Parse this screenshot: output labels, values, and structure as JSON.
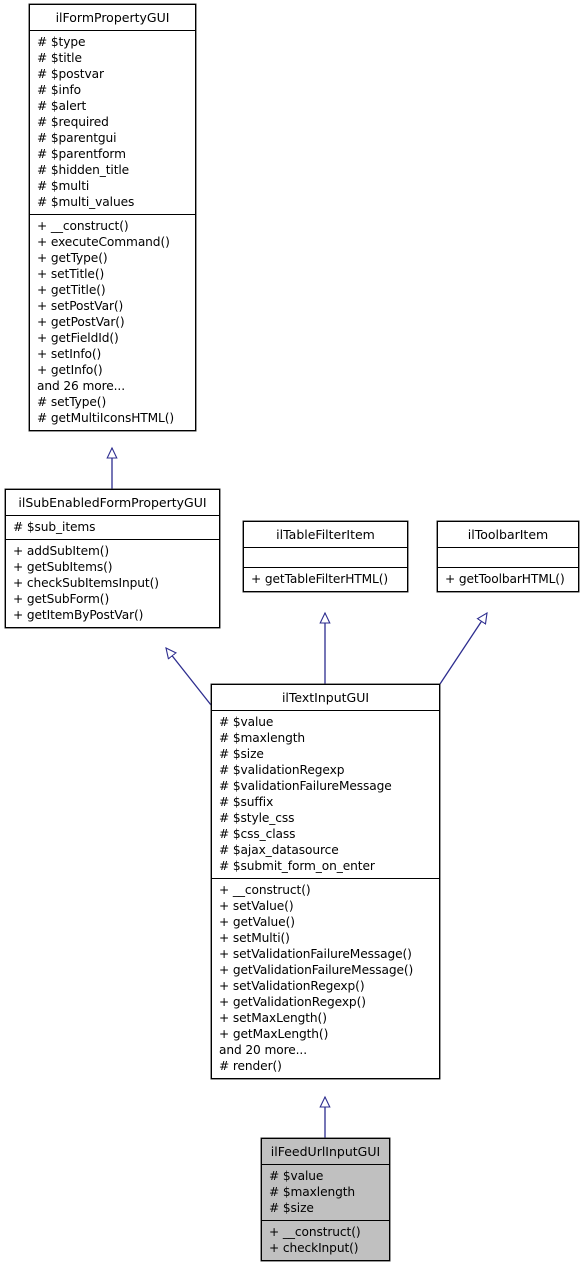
{
  "diagram": {
    "type": "uml-class-inheritance",
    "title": "ilFeedUrlInputGUI inheritance diagram",
    "edge_color": "#2d2d8f",
    "box_border_color": "#000000",
    "highlight_fill": "#c0c0c0",
    "background": "#ffffff"
  },
  "classes": {
    "form_property": {
      "name": "ilFormPropertyGUI",
      "attributes": [
        "#  $type",
        "#  $title",
        "#  $postvar",
        "#  $info",
        "#  $alert",
        "#  $required",
        "#  $parentgui",
        "#  $parentform",
        "#  $hidden_title",
        "#  $multi",
        "#  $multi_values"
      ],
      "operations": [
        "+  __construct()",
        "+  executeCommand()",
        "+  getType()",
        "+  setTitle()",
        "+  getTitle()",
        "+  setPostVar()",
        "+  getPostVar()",
        "+  getFieldId()",
        "+  setInfo()",
        "+  getInfo()",
        "and 26 more...",
        "#  setType()",
        "#  getMultiIconsHTML()"
      ]
    },
    "sub_enabled": {
      "name": "ilSubEnabledFormPropertyGUI",
      "attributes": [
        "#  $sub_items"
      ],
      "operations": [
        "+  addSubItem()",
        "+  getSubItems()",
        "+  checkSubItemsInput()",
        "+  getSubForm()",
        "+  getItemByPostVar()"
      ]
    },
    "table_filter": {
      "name": "ilTableFilterItem",
      "attributes": [],
      "operations": [
        "+  getTableFilterHTML()"
      ]
    },
    "toolbar_item": {
      "name": "ilToolbarItem",
      "attributes": [],
      "operations": [
        "+  getToolbarHTML()"
      ]
    },
    "text_input": {
      "name": "ilTextInputGUI",
      "attributes": [
        "#  $value",
        "#  $maxlength",
        "#  $size",
        "#  $validationRegexp",
        "#  $validationFailureMessage",
        "#  $suffix",
        "#  $style_css",
        "#  $css_class",
        "#  $ajax_datasource",
        "#  $submit_form_on_enter"
      ],
      "operations": [
        "+  __construct()",
        "+  setValue()",
        "+  getValue()",
        "+  setMulti()",
        "+  setValidationFailureMessage()",
        "+  getValidationFailureMessage()",
        "+  setValidationRegexp()",
        "+  getValidationRegexp()",
        "+  setMaxLength()",
        "+  getMaxLength()",
        "and 20 more...",
        "#  render()"
      ]
    },
    "feed_url": {
      "name": "ilFeedUrlInputGUI",
      "attributes": [
        "#  $value",
        "#  $maxlength",
        "#  $size"
      ],
      "operations": [
        "+  __construct()",
        "+  checkInput()"
      ]
    }
  }
}
